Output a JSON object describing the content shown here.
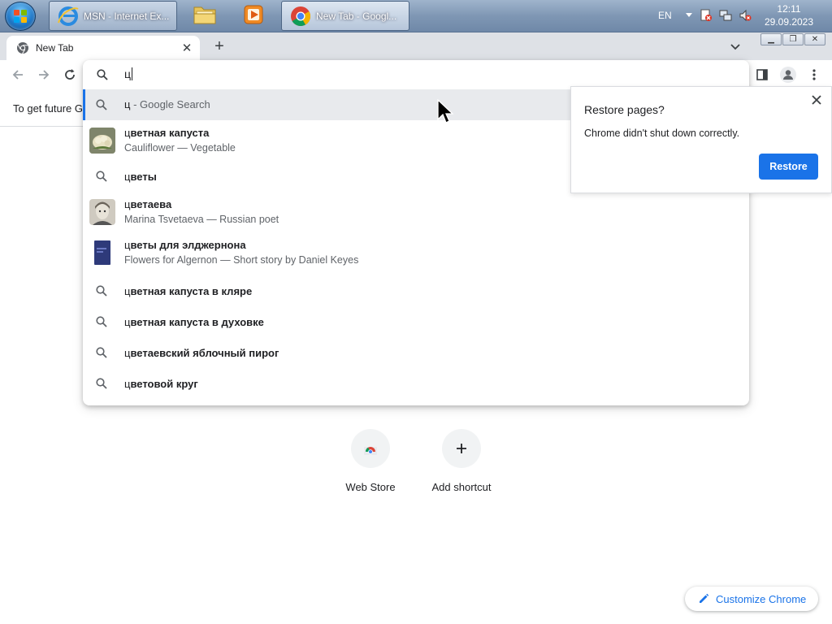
{
  "taskbar": {
    "buttons": [
      {
        "label": "MSN - Internet Ex...",
        "icon": "ie-icon"
      },
      {
        "label": "",
        "icon": "folder-icon"
      },
      {
        "label": "",
        "icon": "media-player-icon"
      },
      {
        "label": "New Tab - Googl...",
        "icon": "chrome-icon"
      }
    ],
    "language": "EN",
    "clock": {
      "time": "12:11",
      "date": "29.09.2023"
    }
  },
  "browser": {
    "tab": {
      "title": "New Tab"
    },
    "colors": {
      "accent": "#1a73e8",
      "tabstrip": "#dee1e6",
      "selected_row": "#e8eaed"
    }
  },
  "omnibox": {
    "value": "ц",
    "suggestions": [
      {
        "type": "search",
        "query": "ц",
        "suffix": " - Google Search",
        "selected": true
      },
      {
        "type": "entity",
        "bold": "ц",
        "rest": "ветная капуста",
        "sub": "Cauliflower — Vegetable",
        "thumb": "cauliflower"
      },
      {
        "type": "search",
        "bold": "ц",
        "rest": "веты"
      },
      {
        "type": "entity",
        "bold": "ц",
        "rest": "ветаева",
        "sub": "Marina Tsvetaeva — Russian poet",
        "thumb": "portrait"
      },
      {
        "type": "entity",
        "bold": "ц",
        "rest": "веты для элджернона",
        "sub": "Flowers for Algernon — Short story by Daniel Keyes",
        "thumb": "book"
      },
      {
        "type": "search",
        "bold": "ц",
        "rest": "ветная капуста в кляре"
      },
      {
        "type": "search",
        "bold": "ц",
        "rest": "ветная капуста в духовке"
      },
      {
        "type": "search",
        "bold": "ц",
        "rest": "ветаевский яблочный пирог"
      },
      {
        "type": "search",
        "bold": "ц",
        "rest": "ветовой круг"
      }
    ]
  },
  "page": {
    "infobar_text": "To get future G",
    "shortcuts": [
      {
        "label": "Web Store"
      },
      {
        "label": "Add shortcut"
      }
    ],
    "customize_label": "Customize Chrome"
  },
  "restore_popup": {
    "title": "Restore pages?",
    "body": "Chrome didn't shut down correctly.",
    "button": "Restore"
  }
}
